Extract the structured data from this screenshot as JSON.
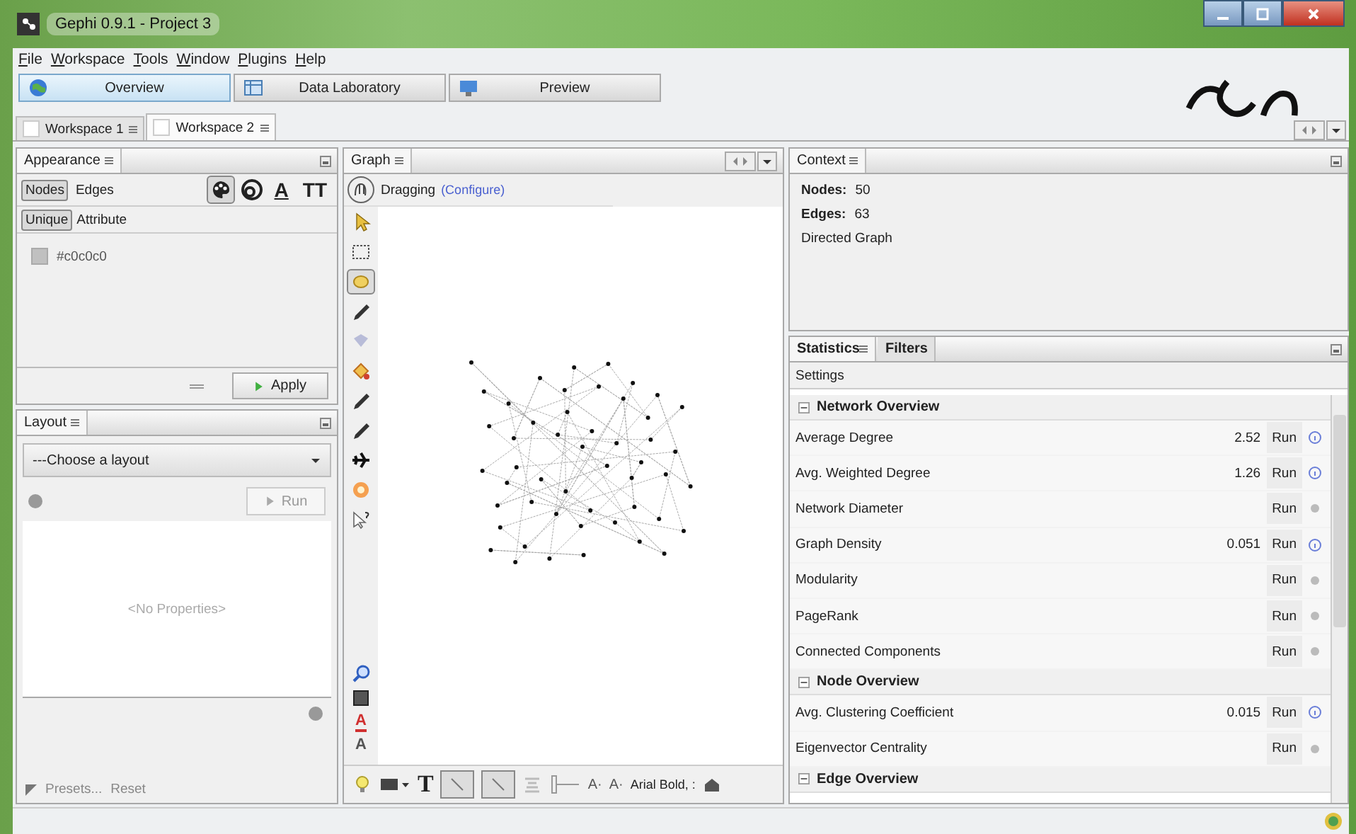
{
  "window": {
    "title": "Gephi 0.9.1 - Project 3"
  },
  "menu": [
    "File",
    "Workspace",
    "Tools",
    "Window",
    "Plugins",
    "Help"
  ],
  "perspectives": [
    {
      "label": "Overview",
      "kind": "globe",
      "selected": true
    },
    {
      "label": "Data Laboratory",
      "kind": "table",
      "selected": false
    },
    {
      "label": "Preview",
      "kind": "monitor",
      "selected": false
    }
  ],
  "workspaces": [
    {
      "label": "Workspace 1",
      "selected": false
    },
    {
      "label": "Workspace 2",
      "selected": true
    }
  ],
  "appearance": {
    "title": "Appearance",
    "targets": [
      {
        "label": "Nodes",
        "selected": true
      },
      {
        "label": "Edges",
        "selected": false
      }
    ],
    "properties": [
      {
        "kind": "palette",
        "selected": true
      },
      {
        "kind": "rings",
        "selected": false
      },
      {
        "kind": "label-color",
        "glyph": "A",
        "selected": false
      },
      {
        "kind": "label-size",
        "glyph": "TT",
        "selected": false
      }
    ],
    "modes": [
      {
        "label": "Unique",
        "selected": true
      },
      {
        "label": "Attribute",
        "selected": false
      }
    ],
    "color": "#c0c0c0",
    "color_value": "#c0c0c0",
    "apply": "Apply"
  },
  "layout": {
    "title": "Layout",
    "dropdown": "---Choose a layout",
    "run": "Run",
    "empty": "<No Properties>",
    "presets": "Presets...",
    "reset": "Reset"
  },
  "graph": {
    "title": "Graph",
    "mode": "Dragging",
    "configure": "(Configure)",
    "tools": [
      {
        "kind": "pointer",
        "selected": false
      },
      {
        "kind": "rect-select",
        "selected": false
      },
      {
        "kind": "drag",
        "selected": true
      },
      {
        "kind": "pencil",
        "selected": false
      },
      {
        "kind": "diamond",
        "selected": false
      },
      {
        "kind": "paint",
        "selected": false
      },
      {
        "kind": "pencil",
        "selected": false
      },
      {
        "kind": "pencil",
        "selected": false
      },
      {
        "kind": "plane",
        "selected": false
      },
      {
        "kind": "flower",
        "selected": false
      },
      {
        "kind": "help-cursor",
        "selected": false
      }
    ],
    "view_tools": [
      {
        "kind": "zoom"
      },
      {
        "kind": "square"
      },
      {
        "kind": "text",
        "glyph": "A",
        "color": "#d03030"
      },
      {
        "kind": "text",
        "glyph": "A",
        "color": "#555555"
      }
    ],
    "bottom": [
      {
        "kind": "bulb"
      },
      {
        "kind": "layers"
      },
      {
        "kind": "text",
        "glyph": "T"
      },
      {
        "kind": "toggle",
        "selected": true
      },
      {
        "kind": "toggle",
        "selected": true
      },
      {
        "kind": "stack"
      },
      {
        "kind": "slider"
      },
      {
        "kind": "text",
        "glyph": "A·"
      },
      {
        "kind": "text",
        "glyph": "A·"
      },
      {
        "kind": "font",
        "glyph": "Arial Bold, :"
      },
      {
        "kind": "home"
      }
    ]
  },
  "context": {
    "title": "Context",
    "nodes_label": "Nodes:",
    "nodes": "50",
    "edges_label": "Edges:",
    "edges": "63",
    "graph_type": "Directed Graph"
  },
  "statistics": {
    "tabs": [
      {
        "label": "Statistics",
        "selected": true
      },
      {
        "label": "Filters",
        "selected": false
      }
    ],
    "settings": "Settings",
    "sections": [
      {
        "title": "Network Overview",
        "expanded": true,
        "rows": [
          {
            "name": "Average Degree",
            "value": "2.52",
            "run": "Run",
            "computed": true
          },
          {
            "name": "Avg. Weighted Degree",
            "value": "1.26",
            "run": "Run",
            "computed": true
          },
          {
            "name": "Network Diameter",
            "run": "Run",
            "computed": false
          },
          {
            "name": "Graph Density",
            "value": "0.051",
            "run": "Run",
            "computed": true
          },
          {
            "name": "Modularity",
            "run": "Run",
            "computed": false
          },
          {
            "name": "PageRank",
            "run": "Run",
            "computed": false
          },
          {
            "name": "Connected Components",
            "run": "Run",
            "computed": false
          }
        ]
      },
      {
        "title": "Node Overview",
        "expanded": true,
        "rows": [
          {
            "name": "Avg. Clustering Coefficient",
            "value": "0.015",
            "run": "Run",
            "computed": true
          },
          {
            "name": "Eigenvector Centrality",
            "run": "Run",
            "computed": false
          }
        ]
      },
      {
        "title": "Edge Overview",
        "expanded": true
      }
    ]
  }
}
